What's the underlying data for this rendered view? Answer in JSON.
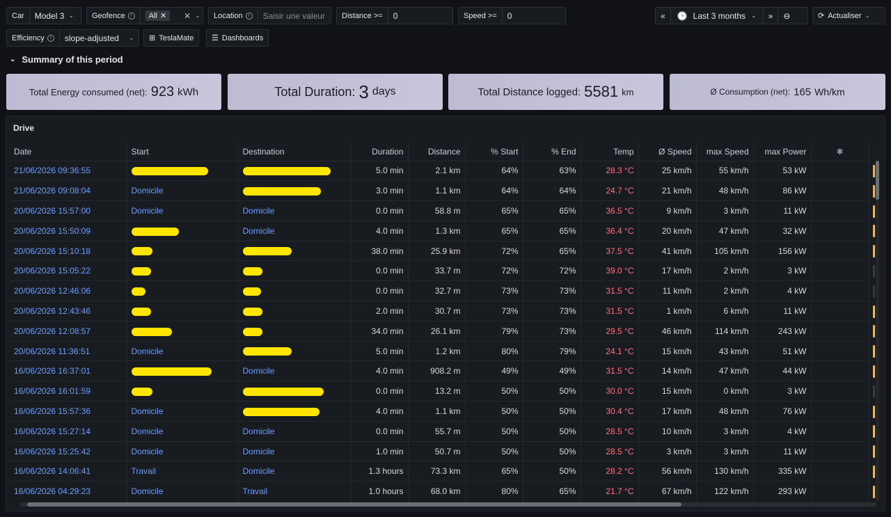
{
  "filters": {
    "car": {
      "label": "Car",
      "value": "Model 3"
    },
    "geofence": {
      "label": "Geofence",
      "chip": "All"
    },
    "location": {
      "label": "Location",
      "placeholder": "Saisir une valeur"
    },
    "distance": {
      "label": "Distance >=",
      "value": "0"
    },
    "speed": {
      "label": "Speed >=",
      "value": "0"
    },
    "efficiency": {
      "label": "Efficiency",
      "value": "slope-adjusted"
    },
    "links": [
      "TeslaMate",
      "Dashboards"
    ]
  },
  "toolbar": {
    "time_range": "Last 3 months",
    "refresh_label": "Actualiser"
  },
  "summary": {
    "title": "Summary of this period",
    "stats": [
      {
        "label": "Total Energy consumed (net):",
        "value": "923",
        "unit": "kWh"
      },
      {
        "label": "Total Duration:",
        "value": "3",
        "unit": "days"
      },
      {
        "label": "Total Distance logged:",
        "value": "5581",
        "unit": "km"
      },
      {
        "label": "Ø Consumption (net):",
        "value": "165",
        "unit": "Wh/km"
      }
    ]
  },
  "drive": {
    "title": "Drive",
    "columns": [
      "Date",
      "Start",
      "Destination",
      "Duration",
      "Distance",
      "% Start",
      "% End",
      "Temp",
      "Ø Speed",
      "max Speed",
      "max Power",
      "❄"
    ],
    "rows": [
      {
        "date": "21/06/2026 09:36:55",
        "start": "",
        "dest": "",
        "duration": "5.0 min",
        "distance": "2.1 km",
        "pstart": "64%",
        "pend": "63%",
        "temp": "28.3 °C",
        "avg": "25 km/h",
        "max": "55 km/h",
        "power": "53 kW"
      },
      {
        "date": "21/06/2026 09:08:04",
        "start": "Domicile",
        "dest": "",
        "duration": "3.0 min",
        "distance": "1.1 km",
        "pstart": "64%",
        "pend": "64%",
        "temp": "24.7 °C",
        "avg": "21 km/h",
        "max": "48 km/h",
        "power": "86 kW"
      },
      {
        "date": "20/06/2026 15:57:00",
        "start": "Domicile",
        "dest": "Domicile",
        "duration": "0.0 min",
        "distance": "58.8 m",
        "pstart": "65%",
        "pend": "65%",
        "temp": "36.5 °C",
        "avg": "9 km/h",
        "max": "3 km/h",
        "power": "11 kW"
      },
      {
        "date": "20/06/2026 15:50:09",
        "start": "",
        "dest": "Domicile",
        "duration": "4.0 min",
        "distance": "1.3 km",
        "pstart": "65%",
        "pend": "65%",
        "temp": "36.4 °C",
        "avg": "20 km/h",
        "max": "47 km/h",
        "power": "32 kW"
      },
      {
        "date": "20/06/2026 15:10:18",
        "start": "",
        "dest": "",
        "duration": "38.0 min",
        "distance": "25.9 km",
        "pstart": "72%",
        "pend": "65%",
        "temp": "37.5 °C",
        "avg": "41 km/h",
        "max": "105 km/h",
        "power": "156 kW"
      },
      {
        "date": "20/06/2026 15:05:22",
        "start": "",
        "dest": "",
        "duration": "0.0 min",
        "distance": "33.7 m",
        "pstart": "72%",
        "pend": "72%",
        "temp": "39.0 °C",
        "avg": "17 km/h",
        "max": "2 km/h",
        "power": "3 kW"
      },
      {
        "date": "20/06/2026 12:46:06",
        "start": "",
        "dest": "",
        "duration": "0.0 min",
        "distance": "32.7 m",
        "pstart": "73%",
        "pend": "73%",
        "temp": "31.5 °C",
        "avg": "11 km/h",
        "max": "2 km/h",
        "power": "4 kW"
      },
      {
        "date": "20/06/2026 12:43:46",
        "start": "",
        "dest": "",
        "duration": "2.0 min",
        "distance": "30.7 m",
        "pstart": "73%",
        "pend": "73%",
        "temp": "31.5 °C",
        "avg": "1 km/h",
        "max": "6 km/h",
        "power": "11 kW"
      },
      {
        "date": "20/06/2026 12:08:57",
        "start": "",
        "dest": "",
        "duration": "34.0 min",
        "distance": "26.1 km",
        "pstart": "79%",
        "pend": "73%",
        "temp": "29.5 °C",
        "avg": "46 km/h",
        "max": "114 km/h",
        "power": "243 kW"
      },
      {
        "date": "20/06/2026 11:36:51",
        "start": "Domicile",
        "dest": "",
        "duration": "5.0 min",
        "distance": "1.2 km",
        "pstart": "80%",
        "pend": "79%",
        "temp": "24.1 °C",
        "avg": "15 km/h",
        "max": "43 km/h",
        "power": "51 kW"
      },
      {
        "date": "16/06/2026 16:37:01",
        "start": "",
        "dest": "Domicile",
        "duration": "4.0 min",
        "distance": "908.2 m",
        "pstart": "49%",
        "pend": "49%",
        "temp": "31.5 °C",
        "avg": "14 km/h",
        "max": "47 km/h",
        "power": "44 kW"
      },
      {
        "date": "16/06/2026 16:01:59",
        "start": "",
        "dest": "",
        "duration": "0.0 min",
        "distance": "13.2 m",
        "pstart": "50%",
        "pend": "50%",
        "temp": "30.0 °C",
        "avg": "15 km/h",
        "max": "0 km/h",
        "power": "3 kW"
      },
      {
        "date": "16/06/2026 15:57:36",
        "start": "Domicile",
        "dest": "",
        "duration": "4.0 min",
        "distance": "1.1 km",
        "pstart": "50%",
        "pend": "50%",
        "temp": "30.4 °C",
        "avg": "17 km/h",
        "max": "48 km/h",
        "power": "76 kW"
      },
      {
        "date": "16/06/2026 15:27:14",
        "start": "Domicile",
        "dest": "Domicile",
        "duration": "0.0 min",
        "distance": "55.7 m",
        "pstart": "50%",
        "pend": "50%",
        "temp": "28.5 °C",
        "avg": "10 km/h",
        "max": "3 km/h",
        "power": "4 kW"
      },
      {
        "date": "16/06/2026 15:25:42",
        "start": "Domicile",
        "dest": "Domicile",
        "duration": "1.0 min",
        "distance": "50.7 m",
        "pstart": "50%",
        "pend": "50%",
        "temp": "28.5 °C",
        "avg": "3 km/h",
        "max": "3 km/h",
        "power": "11 kW"
      },
      {
        "date": "16/06/2026 14:06:41",
        "start": "Travail",
        "dest": "Domicile",
        "duration": "1.3 hours",
        "distance": "73.3 km",
        "pstart": "65%",
        "pend": "50%",
        "temp": "28.2 °C",
        "avg": "56 km/h",
        "max": "130 km/h",
        "power": "335 kW"
      },
      {
        "date": "16/06/2026 04:29:23",
        "start": "Domicile",
        "dest": "Travail",
        "duration": "1.0 hours",
        "distance": "68.0 km",
        "pstart": "80%",
        "pend": "65%",
        "temp": "21.7 °C",
        "avg": "67 km/h",
        "max": "122 km/h",
        "power": "293 kW"
      }
    ]
  },
  "colors": {
    "background": "#111217",
    "panel": "#181b1f",
    "link": "#6e9fff",
    "temp": "#ff7383",
    "stat_bg": "#c3c1d8",
    "redaction": "#ffe600"
  }
}
